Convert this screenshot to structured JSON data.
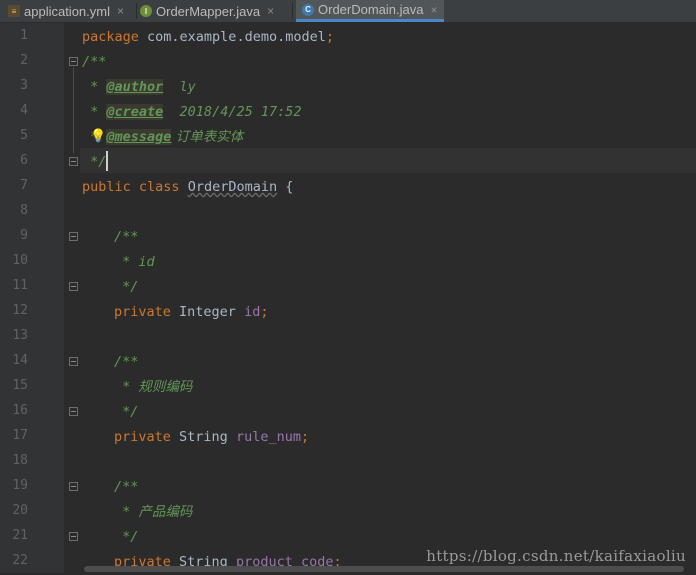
{
  "tabs": [
    {
      "label": "application.yml",
      "icon": "yml-file-icon",
      "icon_glyph": "≡",
      "active": false
    },
    {
      "label": "OrderMapper.java",
      "icon": "interface-icon",
      "icon_glyph": "I",
      "active": false
    },
    {
      "label": "OrderDomain.java",
      "icon": "class-icon",
      "icon_glyph": "C",
      "active": true
    }
  ],
  "close_glyph": "×",
  "line_numbers": [
    "1",
    "2",
    "3",
    "4",
    "5",
    "6",
    "7",
    "8",
    "9",
    "10",
    "11",
    "12",
    "13",
    "14",
    "15",
    "16",
    "17",
    "18",
    "19",
    "20",
    "21",
    "22"
  ],
  "code": {
    "l1": {
      "kw": "package",
      "rest": " com.example.demo.model",
      "semi": ";"
    },
    "l2": {
      "text": "/**"
    },
    "l3": {
      "star": " * ",
      "tag": "@author",
      "val": "  ly"
    },
    "l4": {
      "star": " * ",
      "tag": "@create",
      "val": "  2018/4/25 17:52"
    },
    "l5": {
      "star": " * ",
      "tag": "@message",
      "val": " 订单表实体"
    },
    "l6": {
      "text": " */"
    },
    "l7": {
      "kw1": "public",
      "kw2": "class",
      "cls": "OrderDomain",
      "brace": " {"
    },
    "l9": {
      "text": "/**"
    },
    "l10": {
      "text": " * id"
    },
    "l11": {
      "text": " */"
    },
    "l12": {
      "kw": "private",
      "type": " Integer ",
      "field": "id",
      "semi": ";"
    },
    "l14": {
      "text": "/**"
    },
    "l15": {
      "star": " * ",
      "text": "规则编码"
    },
    "l16": {
      "text": " */"
    },
    "l17": {
      "kw": "private",
      "type": " String ",
      "field": "rule_num",
      "semi": ";"
    },
    "l19": {
      "text": "/**"
    },
    "l20": {
      "star": " * ",
      "text": "产品编码"
    },
    "l21": {
      "text": " */"
    },
    "l22": {
      "kw": "private",
      "type": " String ",
      "field": "product_code",
      "semi": ";"
    }
  },
  "watermark": "https://blog.csdn.net/kaifaxiaoliu",
  "colors": {
    "keyword": "#cc7832",
    "comment": "#629755",
    "field": "#9876aa",
    "text": "#a9b7c6",
    "background": "#2b2b2b"
  }
}
